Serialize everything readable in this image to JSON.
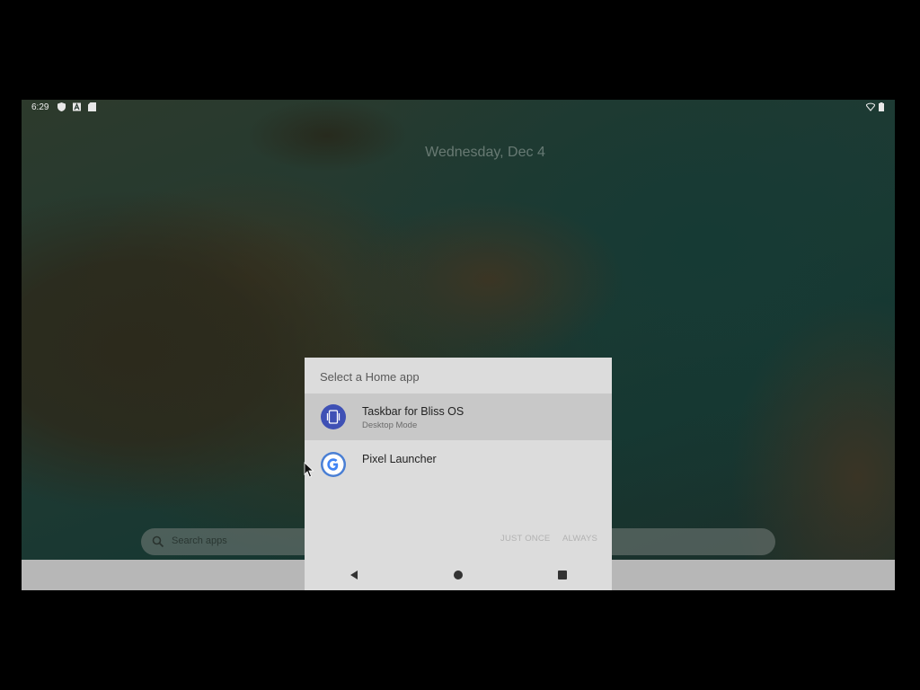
{
  "statusbar": {
    "time": "6:29",
    "left_icons": [
      "shield-icon",
      "font-a-icon",
      "sd-card-icon"
    ],
    "right_icons": [
      "wifi-icon",
      "battery-icon"
    ]
  },
  "homescreen": {
    "date": "Wednesday, Dec 4",
    "search_placeholder": "Search apps"
  },
  "dialog": {
    "title": "Select a Home app",
    "apps": [
      {
        "name": "Taskbar for Bliss OS",
        "subtitle": "Desktop Mode",
        "icon": "taskbar-app-icon",
        "selected": true
      },
      {
        "name": "Pixel Launcher",
        "subtitle": "",
        "icon": "google-g-icon",
        "selected": false
      }
    ],
    "buttons": {
      "just_once": "JUST ONCE",
      "always": "ALWAYS"
    }
  },
  "navigation": {
    "buttons": [
      "back-icon",
      "home-icon",
      "recents-icon"
    ]
  },
  "colors": {
    "dialog_bg": "#dcdcdc",
    "selected_row": "#c8c8c8",
    "taskbar_icon": "#3f51b5",
    "disabled_button": "#b2b2b2"
  }
}
